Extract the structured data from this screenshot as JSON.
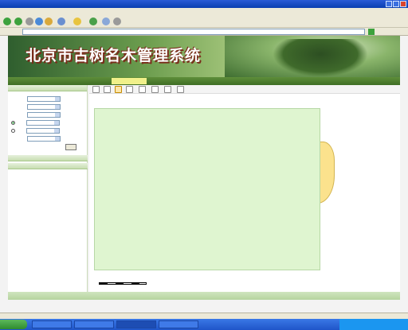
{
  "window": {
    "title": ""
  },
  "menu": [],
  "address": {
    "label": "",
    "url": ""
  },
  "banner": {
    "title": "北京市古树名木管理系统"
  },
  "nav": {
    "items": [
      "",
      "",
      "",
      "",
      "",
      "",
      ""
    ],
    "active_index": 2,
    "datetime": ""
  },
  "sidebar": {
    "sections": [
      "",
      "",
      ""
    ],
    "form": {
      "district_label": "",
      "district_value": "",
      "town_label": "",
      "town_value": "",
      "village_label": "",
      "village_value": "",
      "name_label": "",
      "name_value": "",
      "species_label": "",
      "species_value": "",
      "grade_label": "",
      "grade_value": ""
    },
    "query_button": ""
  },
  "results": {
    "columns": [
      "",
      "",
      "",
      "",
      "",
      "",
      "",
      ""
    ],
    "rows": [
      [
        "",
        "",
        "",
        "",
        "",
        "",
        "",
        ""
      ],
      [
        "",
        "",
        "",
        "",
        "",
        "",
        "",
        ""
      ],
      [
        "",
        "",
        "",
        "",
        "",
        "",
        "",
        ""
      ],
      [
        "",
        "",
        "",
        "",
        "",
        "",
        "",
        ""
      ],
      [
        "",
        "",
        "",
        "",
        "",
        "",
        "",
        ""
      ],
      [
        "",
        "",
        "",
        "",
        "",
        "",
        "",
        ""
      ],
      [
        "",
        "",
        "",
        "",
        "",
        "",
        "",
        ""
      ],
      [
        "",
        "",
        "",
        "",
        "",
        "",
        "",
        ""
      ],
      [
        "",
        "",
        "",
        "",
        "",
        "",
        "",
        ""
      ],
      [
        "",
        "",
        "",
        "",
        "",
        "",
        "",
        ""
      ],
      [
        "",
        "",
        "",
        "",
        "",
        "",
        "",
        ""
      ],
      [
        "",
        "",
        "",
        "",
        "",
        "",
        "",
        ""
      ],
      [
        "",
        "",
        "",
        "",
        "",
        "",
        "",
        ""
      ],
      [
        "",
        "",
        "",
        "",
        "",
        "",
        "",
        ""
      ],
      [
        "",
        "",
        "",
        "",
        "",
        "",
        "",
        ""
      ],
      [
        "",
        "",
        "",
        "",
        "",
        "",
        "",
        ""
      ],
      [
        "",
        "",
        "",
        "",
        "",
        "",
        "",
        ""
      ],
      [
        "",
        "",
        "",
        "",
        "",
        "",
        "",
        ""
      ],
      [
        "",
        "",
        "",
        "",
        "",
        "",
        "",
        ""
      ],
      [
        "",
        "",
        "",
        "",
        "",
        "",
        "",
        ""
      ],
      [
        "",
        "",
        "",
        "",
        "",
        "",
        "",
        ""
      ],
      [
        "",
        "",
        "",
        "",
        "",
        "",
        "",
        ""
      ],
      [
        "",
        "",
        "",
        "",
        "",
        "",
        "",
        ""
      ],
      [
        "",
        "",
        "",
        "",
        "",
        "",
        "",
        ""
      ],
      [
        "",
        "",
        "",
        "",
        "",
        "",
        "",
        ""
      ],
      [
        "",
        "",
        "",
        "",
        "",
        "",
        "",
        ""
      ]
    ],
    "pager": ""
  },
  "scale": {
    "label": ""
  },
  "footer": "",
  "status": "",
  "taskbar": {
    "start": "",
    "tasks": [
      "",
      "",
      "",
      ""
    ],
    "clock": ""
  },
  "colors": {
    "accent_green": "#3f6e25",
    "highlight": "#f0f08a",
    "map_region": "#fbe28d"
  }
}
